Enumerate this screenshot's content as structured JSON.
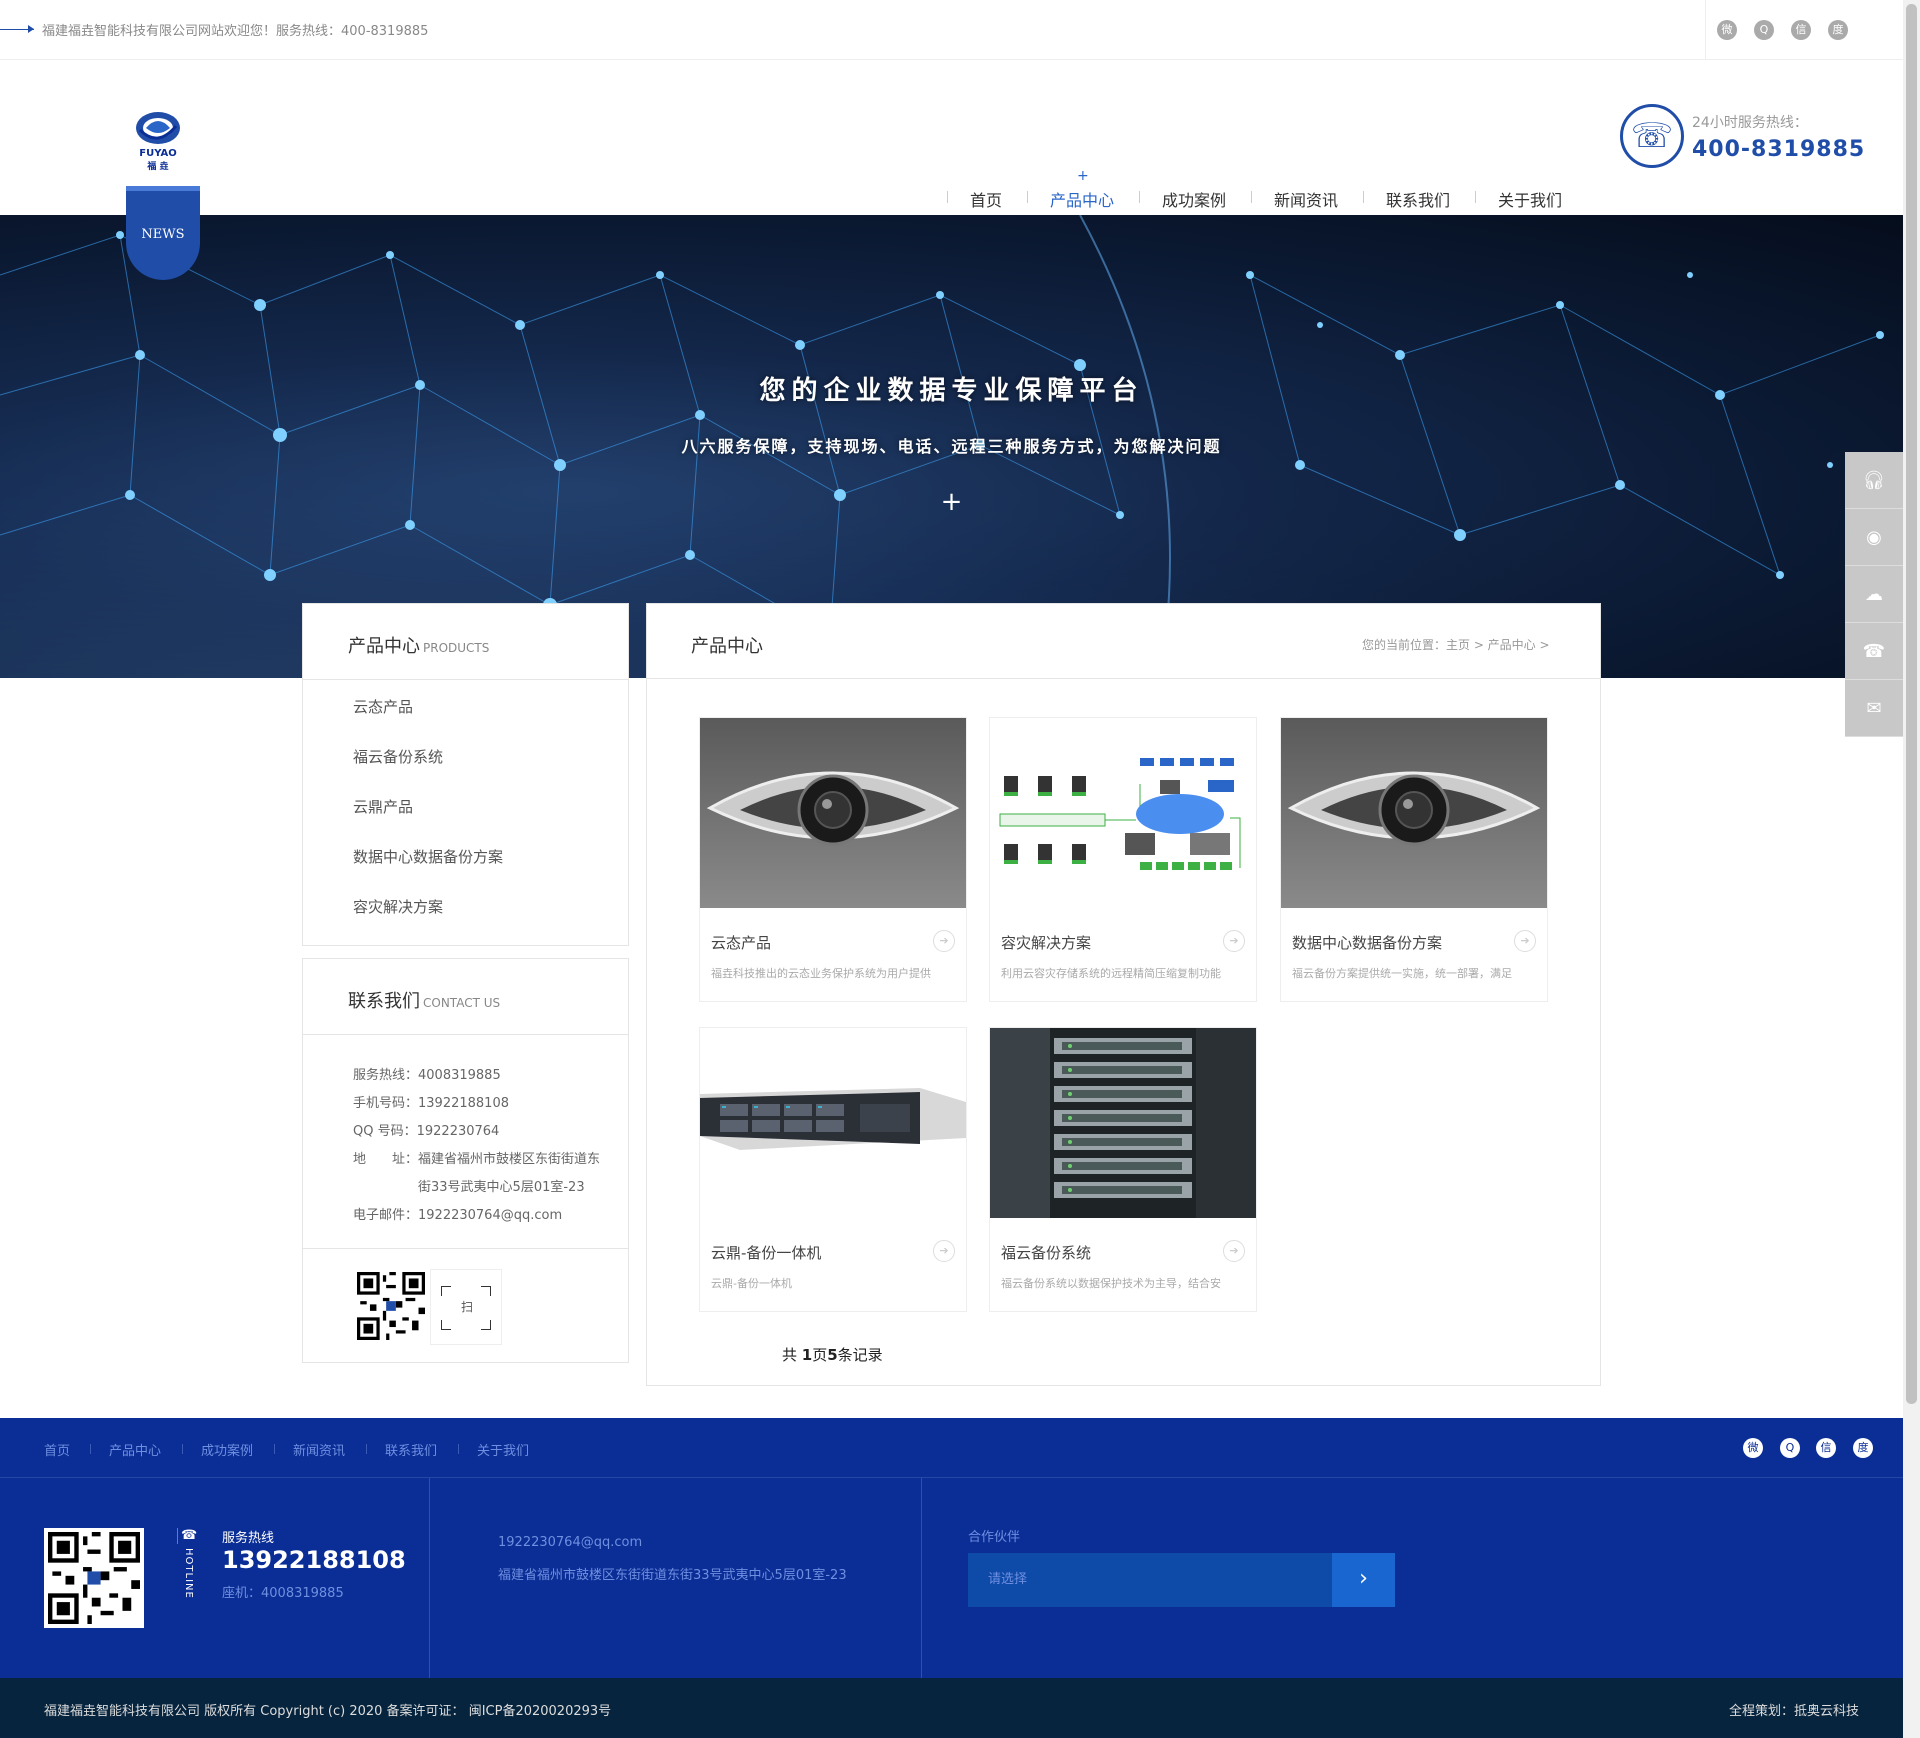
{
  "topbar": {
    "welcome": "福建福垚智能科技有限公司网站欢迎您！服务热线：400-8319885",
    "social": [
      "weibo-icon",
      "qq-icon",
      "wechat-icon",
      "baidu-icon"
    ]
  },
  "header": {
    "logo_text": "FUYAO",
    "logo_sub": "福 垚",
    "news_tag": "NEWS",
    "nav": [
      "首页",
      "产品中心",
      "成功案例",
      "新闻资讯",
      "联系我们",
      "关于我们"
    ],
    "active_nav": "产品中心",
    "nav_plus": "+",
    "hotline_label": "24小时服务热线：",
    "hotline_number": "400-8319885"
  },
  "banner": {
    "title": "您的企业数据专业保障平台",
    "subtitle": "八六服务保障，支持现场、电话、远程三种服务方式，为您解决问题",
    "plus": "+"
  },
  "side_float": [
    "headset-icon",
    "qq-icon",
    "wechat-icon",
    "phone-icon",
    "message-icon"
  ],
  "sidebar": {
    "products_title": "产品中心",
    "products_title_en": "PRODUCTS",
    "products": [
      "云态产品",
      "福云备份系统",
      "云鼎产品",
      "数据中心数据备份方案",
      "容灾解决方案"
    ],
    "contact_title": "联系我们",
    "contact_title_en": "CONTACT US",
    "contact": [
      {
        "label": "服务热线：",
        "value": "4008319885"
      },
      {
        "label": "手机号码：",
        "value": "13922188108"
      },
      {
        "label": "QQ 号码：",
        "value": "1922230764"
      },
      {
        "label": "地　　址：",
        "value": "福建省福州市鼓楼区东街街道东"
      },
      {
        "label": "",
        "value": "街33号武夷中心5层01室-23"
      },
      {
        "label": "电子邮件：",
        "value": "1922230764@qq.com"
      }
    ],
    "scan_label": "扫"
  },
  "main": {
    "title": "产品中心",
    "breadcrumb": "您的当前位置：主页 > 产品中心 >",
    "products": [
      {
        "name": "云态产品",
        "desc": "福垚科技推出的云态业务保护系统为用户提供",
        "image": "camera"
      },
      {
        "name": "容灾解决方案",
        "desc": "利用云容灾存储系统的远程精简压缩复制功能",
        "image": "diagram"
      },
      {
        "name": "数据中心数据备份方案",
        "desc": "福云备份方案提供统一实施，统一部署，满足",
        "image": "camera"
      },
      {
        "name": "云鼎-备份一体机",
        "desc": "云鼎-备份一体机",
        "image": "server"
      },
      {
        "name": "福云备份系统",
        "desc": "福云备份系统以数据保护技术为主导，结合安",
        "image": "rack"
      }
    ],
    "pager_parts": [
      "共 ",
      "1",
      "页",
      "5",
      "条记录"
    ]
  },
  "footer": {
    "nav": [
      "首页",
      "产品中心",
      "成功案例",
      "新闻资讯",
      "联系我们",
      "关于我们"
    ],
    "social": [
      "weibo-icon",
      "qq-icon",
      "wechat-icon",
      "baidu-icon"
    ],
    "hotline_vertical": "HOTLINE",
    "hotline_label": "服务热线",
    "mobile": "13922188108",
    "tel": "座机：4008319885",
    "email": "1922230764@qq.com",
    "address": "福建省福州市鼓楼区东街街道东街33号武夷中心5层01室-23",
    "partner_label": "合作伙伴",
    "partner_placeholder": "请选择",
    "copyright": "福建福垚智能科技有限公司 版权所有 Copyright (c) 2020 备案许可证：  闽ICP备2020020293号",
    "credit": "全程策划：抵奥云科技"
  },
  "colors": {
    "brand": "#1f4da8",
    "footer": "#0b2e96",
    "footer_bottom": "#06243d",
    "link_blue": "#6f8fe0"
  }
}
